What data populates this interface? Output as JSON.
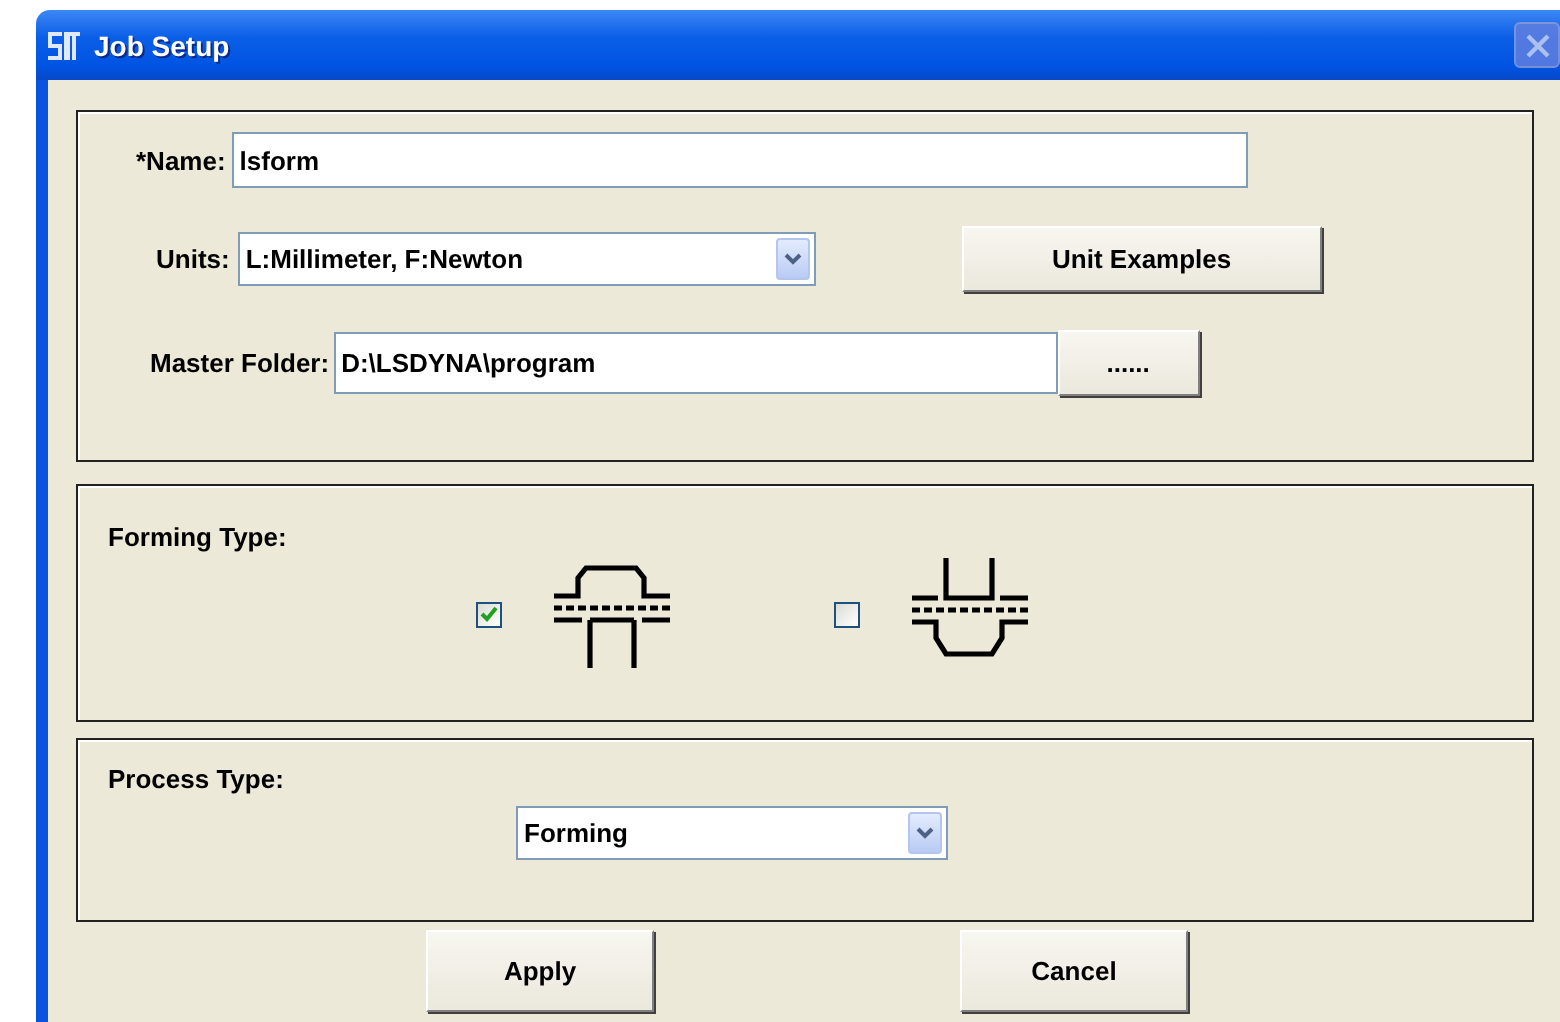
{
  "window": {
    "title": "Job Setup"
  },
  "job": {
    "name_label": "*Name:",
    "name_value": "lsform",
    "units_label": "Units:",
    "units_value": "L:Millimeter, F:Newton",
    "unit_examples_button": "Unit Examples",
    "master_folder_label": "Master Folder:",
    "master_folder_value": "D:\\LSDYNA\\program",
    "browse_button": "......"
  },
  "forming_type": {
    "label": "Forming Type:",
    "options": [
      {
        "kind": "punch-up",
        "checked": true
      },
      {
        "kind": "punch-down",
        "checked": false
      }
    ]
  },
  "process_type": {
    "label": "Process Type:",
    "value": "Forming"
  },
  "buttons": [
    "Apply",
    "Cancel"
  ]
}
